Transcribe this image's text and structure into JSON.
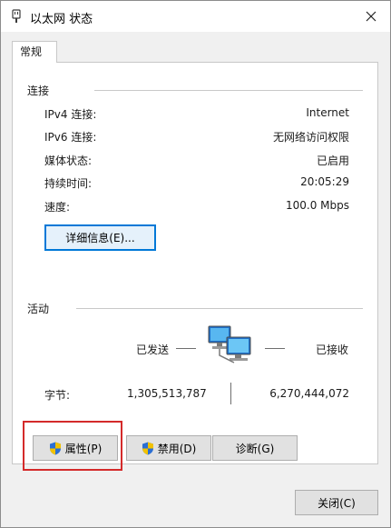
{
  "window": {
    "title": "以太网 状态",
    "close_glyph": "✕",
    "title_icon": "ethernet-icon"
  },
  "tabs": [
    {
      "label": "常规",
      "active": true
    }
  ],
  "connection": {
    "group_label": "连接",
    "rows": [
      {
        "label": "IPv4 连接:",
        "value": "Internet"
      },
      {
        "label": "IPv6 连接:",
        "value": "无网络访问权限"
      },
      {
        "label": "媒体状态:",
        "value": "已启用"
      },
      {
        "label": "持续时间:",
        "value": "20:05:29"
      },
      {
        "label": "速度:",
        "value": "100.0 Mbps"
      }
    ],
    "details_button": "详细信息(E)..."
  },
  "activity": {
    "group_label": "活动",
    "sent_label": "已发送",
    "received_label": "已接收",
    "bytes_label": "字节:",
    "bytes_sent": "1,305,513,787",
    "bytes_received": "6,270,444,072",
    "icon": "network-computers-icon"
  },
  "actions": {
    "properties": "属性(P)",
    "disable": "禁用(D)",
    "diagnose": "诊断(G)"
  },
  "footer": {
    "close": "关闭(C)"
  },
  "colors": {
    "accent": "#0078d7",
    "highlight": "#d42a2a",
    "shield_blue": "#2b6fd4",
    "shield_yellow": "#f2c200"
  }
}
